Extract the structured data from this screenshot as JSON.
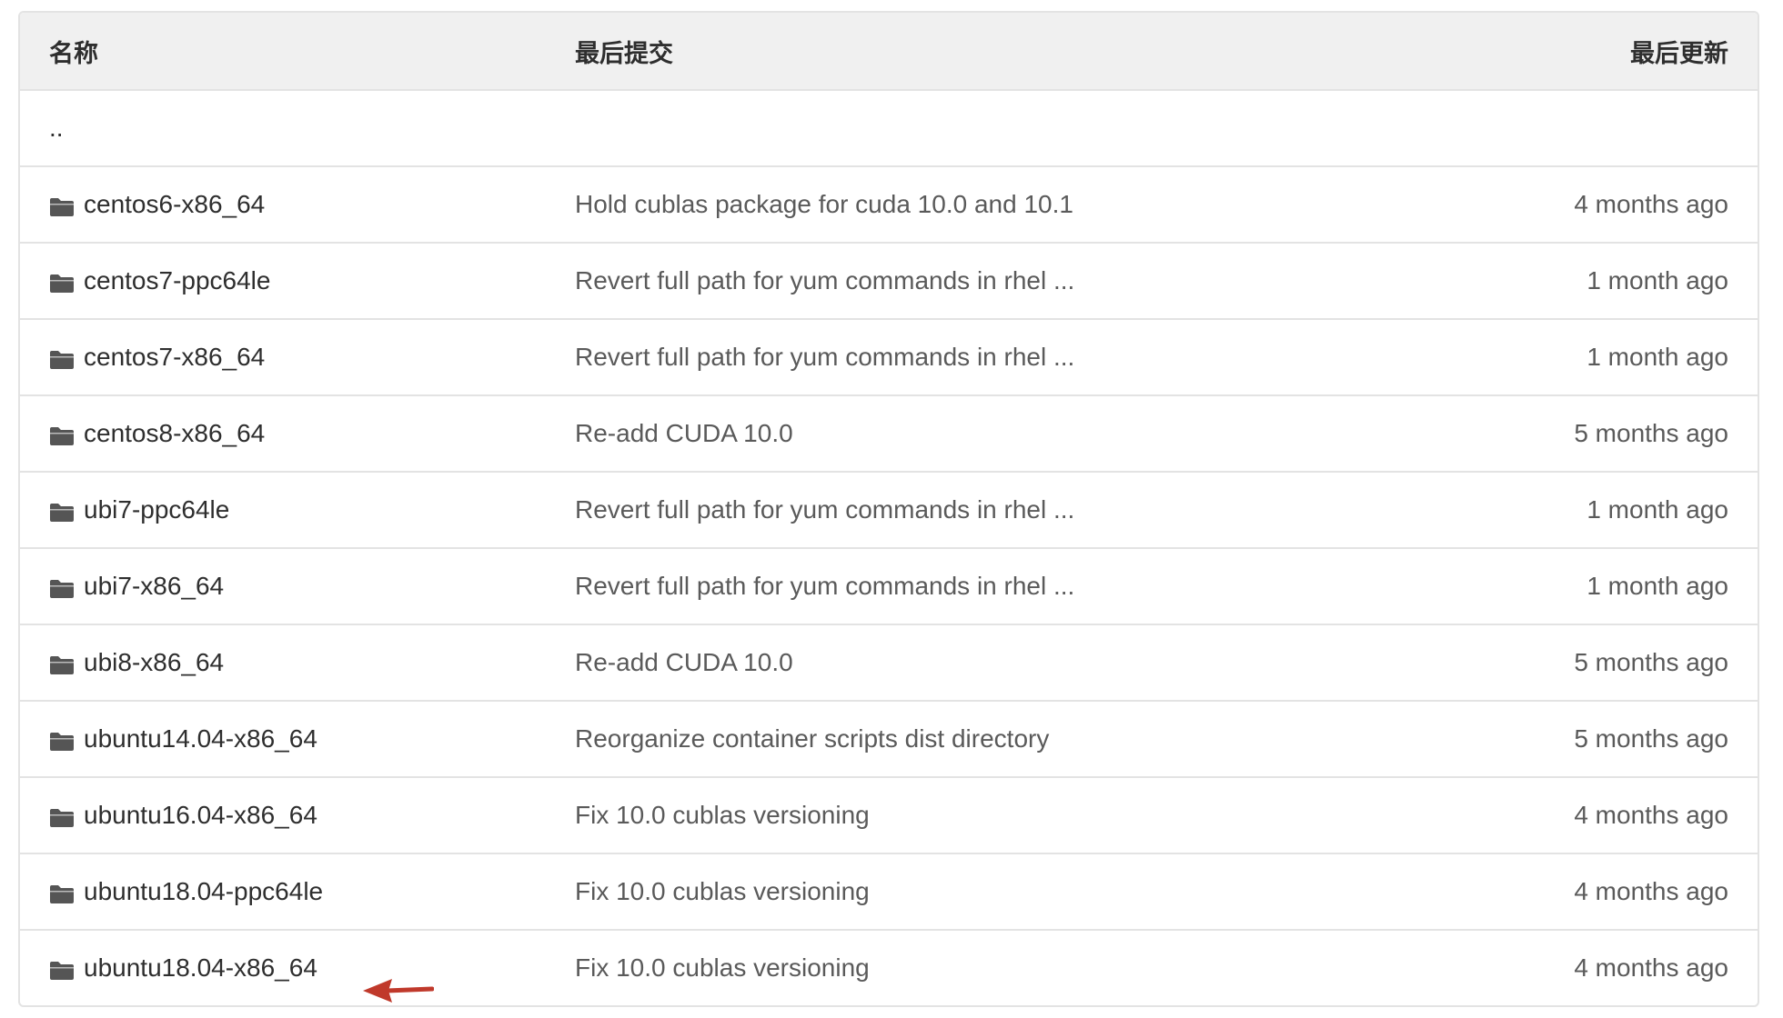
{
  "header": {
    "name": "名称",
    "last_commit": "最后提交",
    "last_update": "最后更新"
  },
  "parent_dir": "..",
  "rows": [
    {
      "name": "centos6-x86_64",
      "commit": "Hold cublas package for cuda 10.0 and 10.1",
      "updated": "4 months ago"
    },
    {
      "name": "centos7-ppc64le",
      "commit": "Revert full path for yum commands in rhel ...",
      "updated": "1 month ago"
    },
    {
      "name": "centos7-x86_64",
      "commit": "Revert full path for yum commands in rhel ...",
      "updated": "1 month ago"
    },
    {
      "name": "centos8-x86_64",
      "commit": "Re-add CUDA 10.0",
      "updated": "5 months ago"
    },
    {
      "name": "ubi7-ppc64le",
      "commit": "Revert full path for yum commands in rhel ...",
      "updated": "1 month ago"
    },
    {
      "name": "ubi7-x86_64",
      "commit": "Revert full path for yum commands in rhel ...",
      "updated": "1 month ago"
    },
    {
      "name": "ubi8-x86_64",
      "commit": "Re-add CUDA 10.0",
      "updated": "5 months ago"
    },
    {
      "name": "ubuntu14.04-x86_64",
      "commit": "Reorganize container scripts dist directory",
      "updated": "5 months ago"
    },
    {
      "name": "ubuntu16.04-x86_64",
      "commit": "Fix 10.0 cublas versioning",
      "updated": "4 months ago"
    },
    {
      "name": "ubuntu18.04-ppc64le",
      "commit": "Fix 10.0 cublas versioning",
      "updated": "4 months ago"
    },
    {
      "name": "ubuntu18.04-x86_64",
      "commit": "Fix 10.0 cublas versioning",
      "updated": "4 months ago"
    }
  ],
  "icons": {
    "folder": "folder-icon",
    "annotation": "red-arrow-icon"
  },
  "colors": {
    "header_bg": "#f0f0f0",
    "border": "#e3e3e3",
    "arrow": "#c0392b",
    "folder": "#555555"
  }
}
